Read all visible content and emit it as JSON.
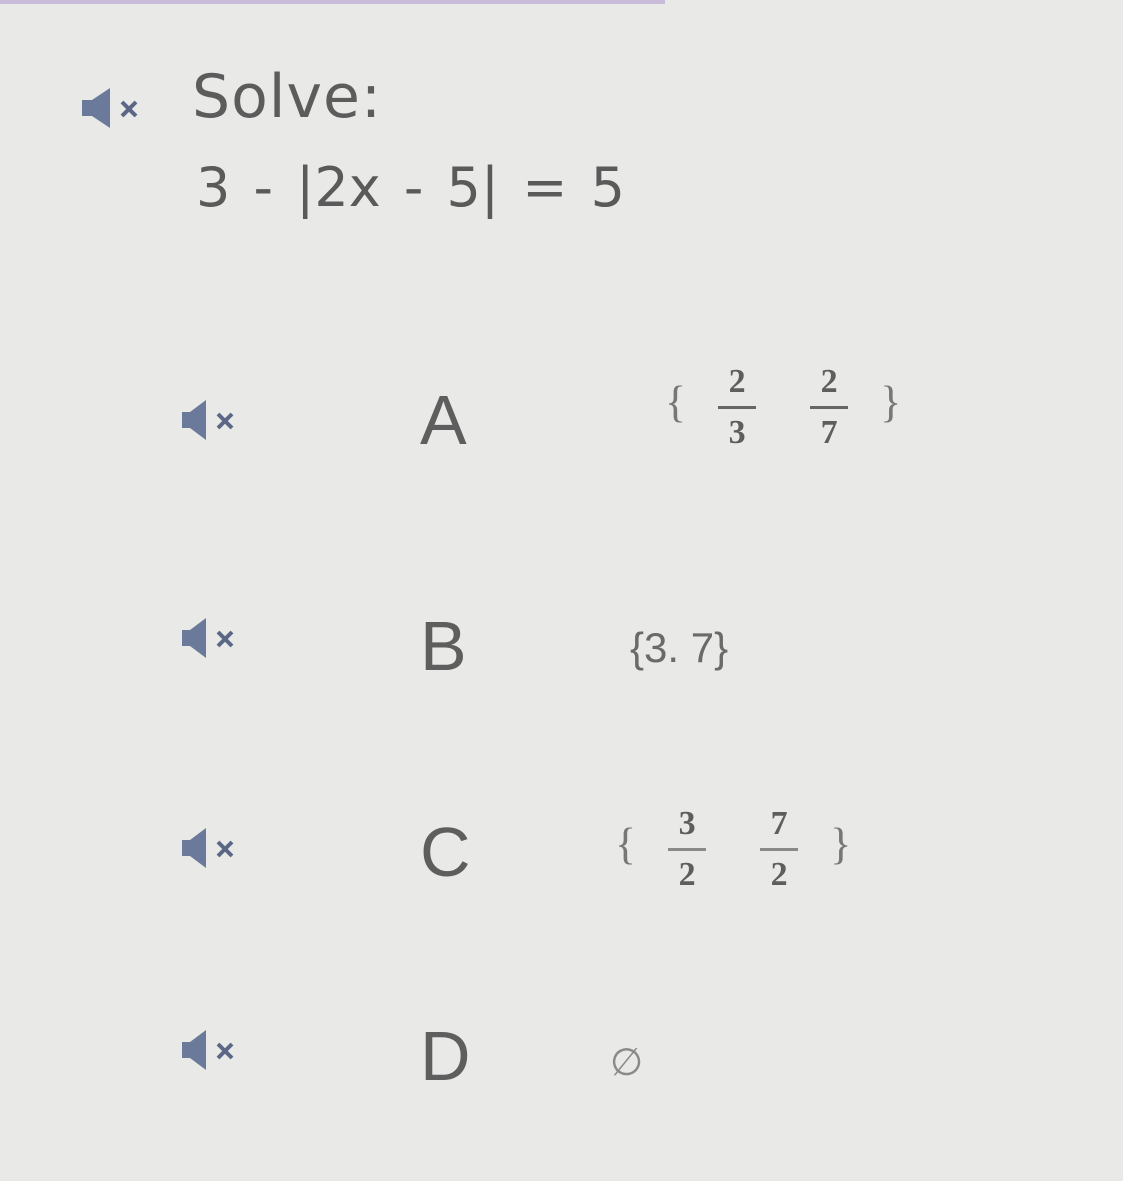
{
  "question": {
    "label": "Solve:",
    "equation": "3 - |2x - 5| = 5",
    "audio_icon": "speaker-muted-icon"
  },
  "choices": [
    {
      "letter": "A",
      "set": {
        "open": "{",
        "close": "}",
        "f1": {
          "num": "2",
          "den": "3"
        },
        "f2": {
          "num": "2",
          "den": "7"
        }
      }
    },
    {
      "letter": "B",
      "text": "{3. 7}"
    },
    {
      "letter": "C",
      "set": {
        "open": "{",
        "close": "}",
        "f1": {
          "num": "3",
          "den": "2"
        },
        "f2": {
          "num": "7",
          "den": "2"
        }
      }
    },
    {
      "letter": "D",
      "text": "∅"
    }
  ],
  "colors": {
    "background": "#e9e9e7",
    "text": "#5c5c5c",
    "icon": "#6b7a9a"
  }
}
